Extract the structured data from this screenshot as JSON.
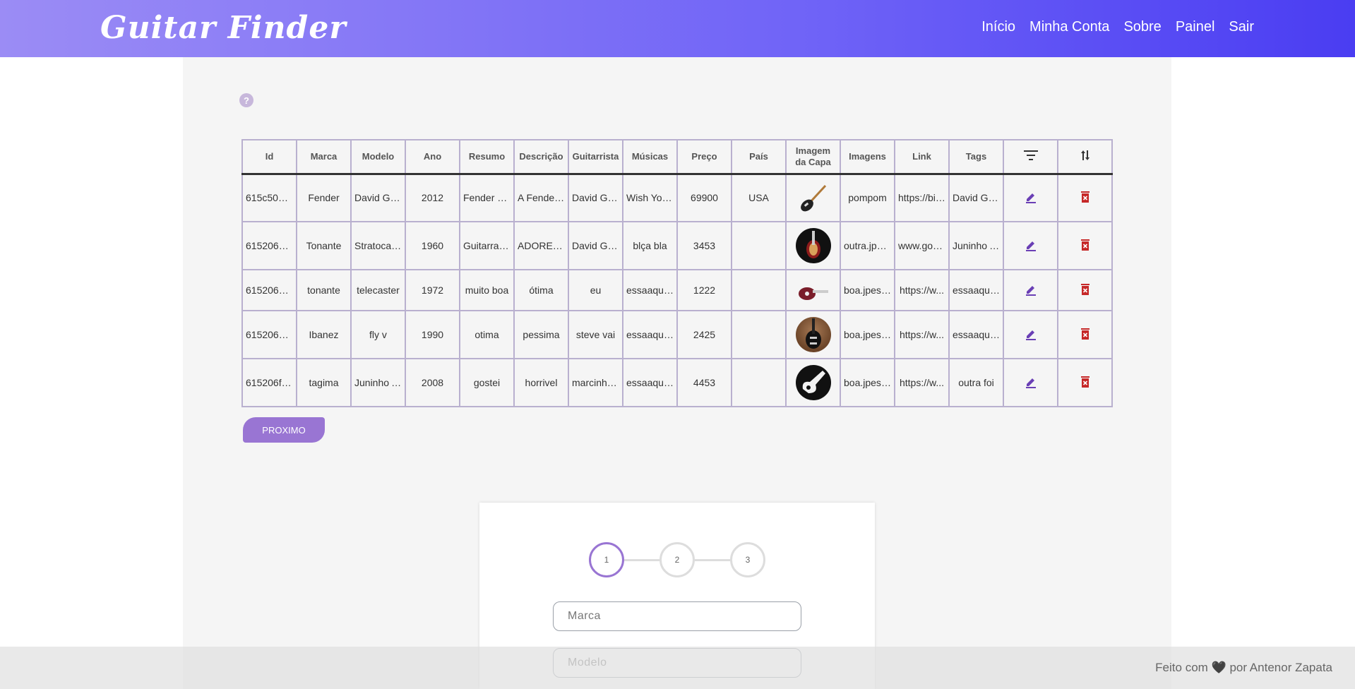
{
  "header": {
    "logo": "Guitar Finder",
    "nav": [
      "Início",
      "Minha Conta",
      "Sobre",
      "Painel",
      "Sair"
    ]
  },
  "help_icon": "?",
  "table": {
    "columns": [
      "Id",
      "Marca",
      "Modelo",
      "Ano",
      "Resumo",
      "Descrição",
      "Guitarrista",
      "Músicas",
      "Preço",
      "País",
      "Imagem da Capa",
      "Imagens",
      "Link",
      "Tags"
    ],
    "rows": [
      [
        "615c506b...",
        "Fender",
        "David Gil...",
        "2012",
        "Fender Cu...",
        "A Fender ...",
        "David Gil...",
        "Wish You ...",
        "69900",
        "USA",
        "",
        "pompom",
        "https://bit....",
        "David GIl..."
      ],
      [
        "61520685...",
        "Tonante",
        "Stratocast...",
        "1960",
        "Guitarra la...",
        "ADOREI E...",
        "David Gil...",
        "blça bla",
        "3453",
        "",
        "",
        "outra.jph ...",
        "www.gov....",
        "Juninho A..."
      ],
      [
        "615206b3...",
        "tonante",
        "telecaster",
        "1972",
        "muito boa",
        "ótima",
        "eu",
        "essaaquela",
        "1222",
        "",
        "",
        "boa.jpess...",
        "https://w...",
        "essaaquela"
      ],
      [
        "615206d0...",
        "Ibanez",
        "fly v",
        "1990",
        "otima",
        "pessima",
        "steve vai",
        "essaaquela",
        "2425",
        "",
        "",
        "boa.jpess...",
        "https://w...",
        "essaaquela"
      ],
      [
        "615206f0...",
        "tagima",
        "Juninho A...",
        "2008",
        "gostei",
        "horrivel",
        "marcinho ...",
        "essaaquela",
        "4453",
        "",
        "",
        "boa.jpess...",
        "https://w...",
        "outra foi"
      ]
    ],
    "icons": {
      "filter": "filter-icon",
      "sort": "sort-icon",
      "edit": "edit-icon",
      "delete": "delete-icon"
    }
  },
  "next_button": "PROXIMO",
  "form": {
    "steps": [
      "1",
      "2",
      "3"
    ],
    "active_step": 1,
    "marca_placeholder": "Marca",
    "modelo_placeholder": "Modelo"
  },
  "footer": {
    "text_before": "Feito com",
    "heart": "🖤",
    "text_after": "por Antenor Zapata"
  },
  "colors": {
    "accent": "#9975d3",
    "delete": "#c62828",
    "edit": "#6a3fb5"
  }
}
